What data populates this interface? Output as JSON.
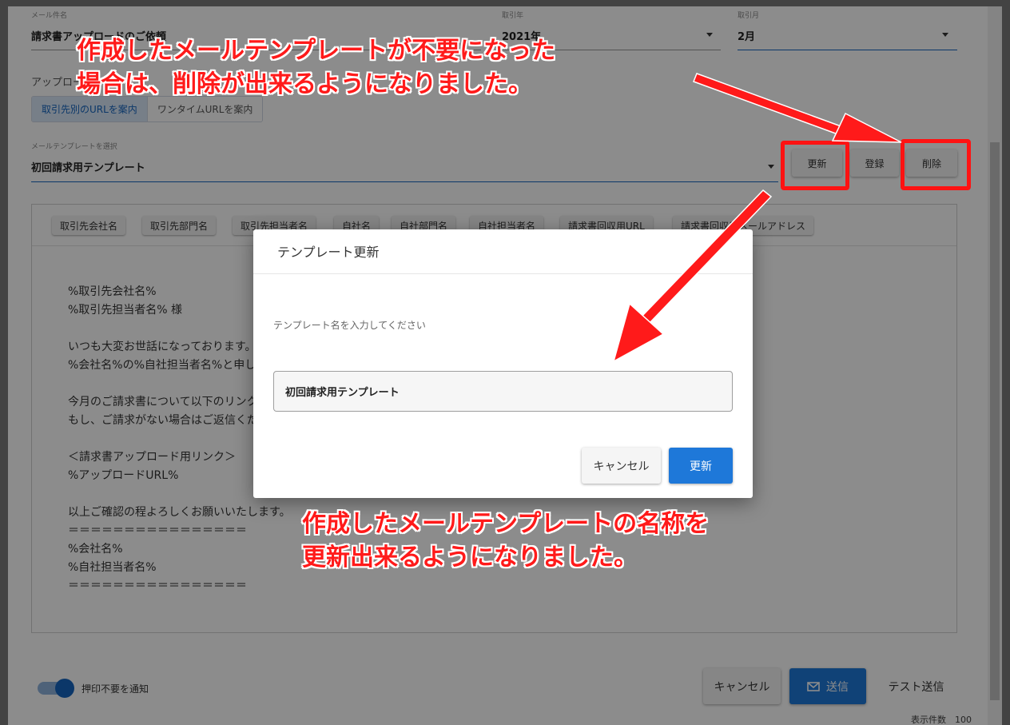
{
  "form": {
    "subject_label": "メール件名",
    "subject_value": "請求書アップロードのご依頼",
    "year_label": "取引年",
    "year_value": "2021年",
    "month_label": "取引月",
    "month_value": "2月",
    "upload_label": "アップロード",
    "upload_options": [
      "取引先別のURLを案内",
      "ワンタイムURLを案内"
    ],
    "template_label": "メールテンプレートを選択",
    "template_value": "初回請求用テンプレート",
    "update_label": "更新",
    "register_label": "登録",
    "delete_label": "削除"
  },
  "editor": {
    "chips": [
      "取引先会社名",
      "取引先部門名",
      "取引先担当者名",
      "自社名",
      "自社部門名",
      "自社担当者名",
      "請求書回収用URL",
      "請求書回収用メールアドレス"
    ],
    "body": "%取引先会社名%\n%取引先担当者名% 様\n\nいつも大変お世話になっております。\n%会社名%の%自社担当者名%と申します。\n\n今月のご請求書について以下のリンクよりアップロードをお願いいたします。\nもし、ご請求がない場合はご返信ください。\n\n＜請求書アップロード用リンク＞\n%アップロードURL%\n\n以上ご確認の程よろしくお願いいたします。\n＝＝＝＝＝＝＝＝＝＝＝＝＝＝＝＝\n%会社名%\n%自社担当者名%\n＝＝＝＝＝＝＝＝＝＝＝＝＝＝＝＝"
  },
  "footer": {
    "switch_label": "押印不要を通知",
    "cancel_label": "キャンセル",
    "send_label": "送信",
    "test_send_label": "テスト送信",
    "behind_text": "表示件数　100"
  },
  "modal": {
    "title": "テンプレート更新",
    "prompt": "テンプレート名を入力してください",
    "input_value": "初回請求用テンプレート",
    "cancel_label": "キャンセル",
    "ok_label": "更新"
  },
  "annotations": {
    "top_line1": "作成したメールテンプレートが不要になった",
    "top_line2": "場合は、削除が出来るようになりました。",
    "bottom_line1": "作成したメールテンプレートの名称を",
    "bottom_line2": "更新出来るようになりました。"
  },
  "colors": {
    "primary": "#1e78d9",
    "annotation_red": "#ff1a1a"
  },
  "icons": {
    "send": "mail-icon",
    "dropdown": "caret-down-icon"
  }
}
